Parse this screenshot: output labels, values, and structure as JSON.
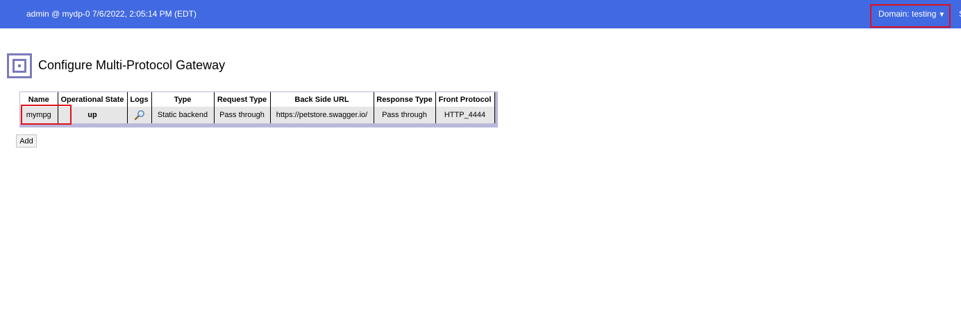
{
  "header": {
    "session_info": "admin @ mydp-0 7/6/2022, 2:05:14 PM (EDT)",
    "domain_label": "Domain: testing",
    "caret": "▼",
    "clipped_char": "S",
    "bar_color": "#4169e1"
  },
  "page": {
    "title": "Configure Multi-Protocol Gateway",
    "icon": "gateway-config-icon",
    "icon_color": "#7b7bbb"
  },
  "table": {
    "columns": [
      "Name",
      "Operational State",
      "Logs",
      "Type",
      "Request Type",
      "Back Side URL",
      "Response Type",
      "Front Protocol"
    ],
    "rows": [
      {
        "name": "mympg",
        "state": "up",
        "logs_icon": "magnifier-icon",
        "type": "Static backend",
        "request_type": "Pass through",
        "back_side_url": "https://petstore.swagger.io/",
        "response_type": "Pass through",
        "front_protocol": "HTTP_4444"
      }
    ]
  },
  "actions": {
    "add_label": "Add"
  },
  "highlight_color": "#e0101a"
}
